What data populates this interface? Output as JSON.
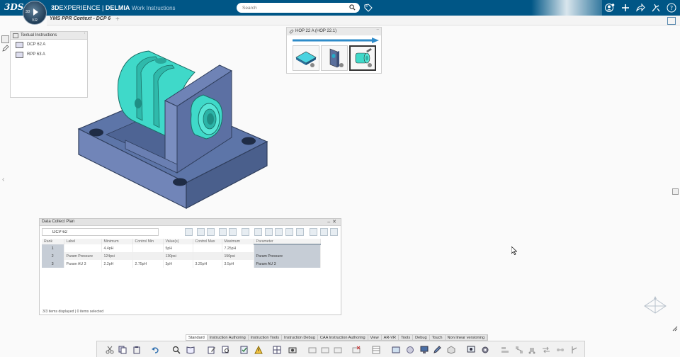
{
  "header": {
    "logo": "ds-logo",
    "compass_label": "3D",
    "compass_version": "V.R",
    "brand_bold": "3D",
    "brand_rest": "EXPERIENCE | ",
    "brand_app_bold": "DELMIA",
    "brand_app": "Work Instructions",
    "search_placeholder": "Search"
  },
  "tabs": {
    "active": "YMS PPR Context - DCP 6",
    "add": "+"
  },
  "tree": {
    "title": "Textual Instructions",
    "items": [
      {
        "label": "DCP 62 A"
      },
      {
        "label": "RPP 63 A"
      }
    ]
  },
  "hop": {
    "title": "HOP 22 A (HOP 22.1)",
    "thumbnails": [
      {
        "icon": "plate-thumbnail-icon",
        "selected": false
      },
      {
        "icon": "bracket-thumbnail-icon",
        "selected": false
      },
      {
        "icon": "cylinder-thumbnail-icon",
        "selected": true
      }
    ]
  },
  "dcp": {
    "title": "Data Collect Plan",
    "search_value": "DCP 62",
    "columns": [
      "Rank",
      "Label",
      "Minimum",
      "Control Min",
      "Value(s)",
      "Control Max",
      "Maximum",
      "Parameter"
    ],
    "rows": [
      [
        "1",
        "",
        "4.4pH",
        "",
        "5pH",
        "",
        "7.25pH",
        ""
      ],
      [
        "2",
        "Param Pressure",
        "124psi",
        "",
        "130psi",
        "",
        "150psi",
        "Param Pressure"
      ],
      [
        "3",
        "Param AU 3",
        "2.2pH",
        "2.75pH",
        "3pH",
        "3.25pH",
        "3.5pH",
        "Param AU 3"
      ]
    ],
    "status": "3/3 items displayed | 0 items selected"
  },
  "action_tabs": [
    {
      "label": "Standard",
      "active": true
    },
    {
      "label": "Instruction Authoring",
      "active": false
    },
    {
      "label": "Instruction Tools",
      "active": false
    },
    {
      "label": "Instruction Debug",
      "active": false
    },
    {
      "label": "CAA Instruction Authoring",
      "active": false
    },
    {
      "label": "View",
      "active": false
    },
    {
      "label": "AR-VR",
      "active": false
    },
    {
      "label": "Tools",
      "active": false
    },
    {
      "label": "Debug",
      "active": false
    },
    {
      "label": "Touch",
      "active": false
    },
    {
      "label": "Non linear versioning",
      "active": false
    }
  ],
  "colors": {
    "topbar": "#005686",
    "part_cyan": "#3fd9c9",
    "base_blue": "#5c74a6"
  }
}
